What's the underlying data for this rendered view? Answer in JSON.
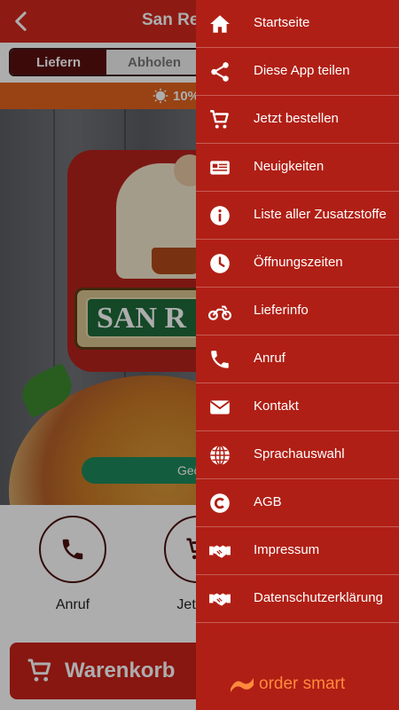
{
  "app": {
    "title": "San Ren",
    "mode_tabs": [
      {
        "label": "Liefern",
        "active": true
      },
      {
        "label": "Abholen",
        "active": false
      }
    ],
    "promo_text": "10%",
    "brand_text": "SAN R",
    "status_pill": "Geö",
    "actions": [
      {
        "label": "Anruf",
        "icon": "phone-icon"
      },
      {
        "label": "Jetzt b",
        "icon": "cart-icon"
      }
    ],
    "cart_label": "Warenkorb"
  },
  "menu": {
    "items": [
      {
        "label": "Startseite",
        "icon": "home-icon"
      },
      {
        "label": "Diese App teilen",
        "icon": "share-icon"
      },
      {
        "label": "Jetzt bestellen",
        "icon": "cart-icon"
      },
      {
        "label": "Neuigkeiten",
        "icon": "newspaper-icon"
      },
      {
        "label": "Liste aller Zusatzstoffe",
        "icon": "info-icon"
      },
      {
        "label": "Öffnungszeiten",
        "icon": "clock-icon"
      },
      {
        "label": "Lieferinfo",
        "icon": "motorcycle-icon"
      },
      {
        "label": "Anruf",
        "icon": "phone-icon"
      },
      {
        "label": "Kontakt",
        "icon": "envelope-icon"
      },
      {
        "label": "Sprachauswahl",
        "icon": "globe-icon"
      },
      {
        "label": "AGB",
        "icon": "copyright-icon"
      },
      {
        "label": "Impressum",
        "icon": "handshake-icon"
      },
      {
        "label": "Datenschutzerklärung",
        "icon": "handshake-icon"
      }
    ],
    "footer_brand": "order smart"
  },
  "colors": {
    "topbar": "#d0281e",
    "drawer": "#b01f15",
    "promo": "#e2631f",
    "cart_button": "#c9211a",
    "open_pill": "#1d8a5c",
    "footer_brand": "#ff8a3d"
  }
}
